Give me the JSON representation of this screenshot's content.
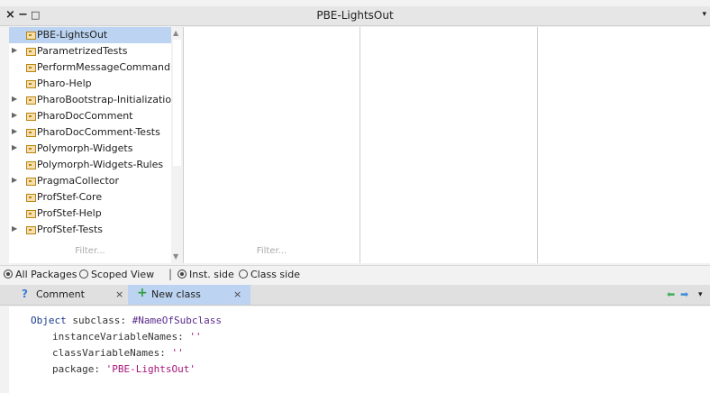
{
  "window": {
    "title": "PBE-LightsOut",
    "close_glyph": "×",
    "minimize_glyph": "−",
    "maximize_glyph": "□",
    "menu_glyph": "▾"
  },
  "packages": [
    {
      "label": "PBE-LightsOut",
      "expandable": false,
      "selected": true
    },
    {
      "label": "ParametrizedTests",
      "expandable": true,
      "selected": false
    },
    {
      "label": "PerformMessageCommandLi",
      "expandable": false,
      "selected": false
    },
    {
      "label": "Pharo-Help",
      "expandable": false,
      "selected": false
    },
    {
      "label": "PharoBootstrap-Initialization",
      "expandable": true,
      "selected": false
    },
    {
      "label": "PharoDocComment",
      "expandable": true,
      "selected": false
    },
    {
      "label": "PharoDocComment-Tests",
      "expandable": true,
      "selected": false
    },
    {
      "label": "Polymorph-Widgets",
      "expandable": true,
      "selected": false
    },
    {
      "label": "Polymorph-Widgets-Rules",
      "expandable": false,
      "selected": false
    },
    {
      "label": "PragmaCollector",
      "expandable": true,
      "selected": false
    },
    {
      "label": "ProfStef-Core",
      "expandable": false,
      "selected": false
    },
    {
      "label": "ProfStef-Help",
      "expandable": false,
      "selected": false
    },
    {
      "label": "ProfStef-Tests",
      "expandable": true,
      "selected": false
    }
  ],
  "filters": {
    "packages_placeholder": "Filter...",
    "classes_placeholder": "Filter..."
  },
  "radios": {
    "all_packages": "All Packages",
    "scoped_view": "Scoped View",
    "separator": "|",
    "inst_side": "Inst. side",
    "class_side": "Class side"
  },
  "tabs": [
    {
      "label": "Comment",
      "icon": "?",
      "close": "×",
      "active": false
    },
    {
      "label": "New class",
      "icon": "+",
      "close": "×",
      "active": true
    }
  ],
  "nav": {
    "back": "◆",
    "forward": "➡",
    "menu": "▾"
  },
  "editor": {
    "line1_receiver": "Object",
    "line1_message": " subclass: ",
    "line1_symbol": "#NameOfSubclass",
    "line2_keyword": "instanceVariableNames: ",
    "line2_value": "''",
    "line3_keyword": "classVariableNames: ",
    "line3_value": "''",
    "line4_keyword": "package: ",
    "line4_value": "'PBE-LightsOut'"
  },
  "colors": {
    "selection": "#bcd4f1",
    "tab_icon_comment": "#3a7bd5",
    "tab_icon_new": "#2e9e3e",
    "nav_green": "#3fae5a",
    "nav_blue": "#3a8fd8"
  }
}
